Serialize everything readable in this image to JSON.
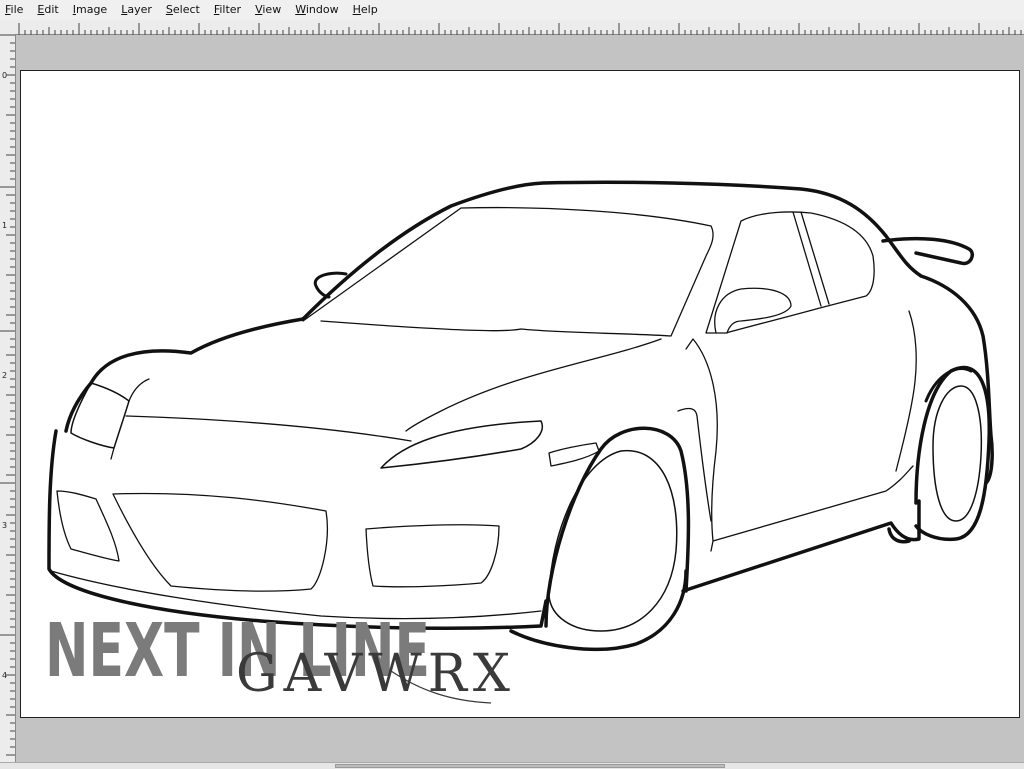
{
  "menu": [
    {
      "label": "File",
      "mnemonic": "F",
      "rest": "ile"
    },
    {
      "label": "Edit",
      "mnemonic": "E",
      "rest": "dit"
    },
    {
      "label": "Image",
      "mnemonic": "I",
      "rest": "mage"
    },
    {
      "label": "Layer",
      "mnemonic": "L",
      "rest": "ayer"
    },
    {
      "label": "Select",
      "mnemonic": "S",
      "rest": "elect"
    },
    {
      "label": "Filter",
      "mnemonic": "F",
      "rest": "ilter"
    },
    {
      "label": "View",
      "mnemonic": "V",
      "rest": "iew"
    },
    {
      "label": "Window",
      "mnemonic": "W",
      "rest": "indow"
    },
    {
      "label": "Help",
      "mnemonic": "H",
      "rest": "elp"
    }
  ],
  "vertical_ruler": {
    "labels": [
      "0",
      "1",
      "2",
      "3",
      "4"
    ]
  },
  "canvas": {
    "subject": "car-line-art",
    "watermark_title": "NEXT IN LINE",
    "watermark_brand": "GAVWRX",
    "colors": {
      "background": "#ffffff",
      "line": "#111111",
      "watermark_title": "#7b7b7b",
      "watermark_brand": "#3a3a3a"
    }
  },
  "colors": {
    "workspace": "#c3c3c3",
    "menubar": "#f0f0f0",
    "ruler": "#ececec"
  }
}
